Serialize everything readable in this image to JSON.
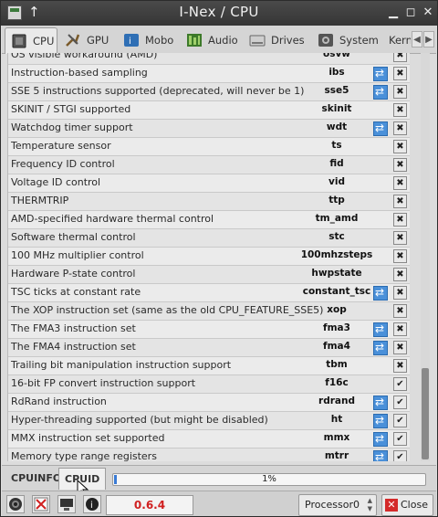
{
  "window": {
    "title": "I-Nex / CPU"
  },
  "tabs": [
    {
      "label": "CPU",
      "icon": "cpu-icon"
    },
    {
      "label": "GPU",
      "icon": "gpu-icon"
    },
    {
      "label": "Mobo",
      "icon": "motherboard-icon"
    },
    {
      "label": "Audio",
      "icon": "audio-icon"
    },
    {
      "label": "Drives",
      "icon": "drive-icon"
    },
    {
      "label": "System",
      "icon": "system-icon"
    },
    {
      "label": "Kern",
      "icon": "kernel-icon"
    }
  ],
  "flags": [
    {
      "desc": "OS visible workaround (AMD)",
      "flag": "osvw",
      "ok": false
    },
    {
      "desc": "Instruction-based sampling",
      "flag": "ibs",
      "ok": true
    },
    {
      "desc": "SSE 5 instructions supported (deprecated, will never be 1)",
      "flag": "sse5",
      "ok": true
    },
    {
      "desc": "SKINIT / STGI supported",
      "flag": "skinit",
      "ok": false
    },
    {
      "desc": "Watchdog timer support",
      "flag": "wdt",
      "ok": true
    },
    {
      "desc": "Temperature sensor",
      "flag": "ts",
      "ok": false
    },
    {
      "desc": "Frequency ID control",
      "flag": "fid",
      "ok": false
    },
    {
      "desc": "Voltage ID control",
      "flag": "vid",
      "ok": false
    },
    {
      "desc": "THERMTRIP",
      "flag": "ttp",
      "ok": false
    },
    {
      "desc": "AMD-specified hardware thermal control",
      "flag": "tm_amd",
      "ok": false
    },
    {
      "desc": "Software thermal control",
      "flag": "stc",
      "ok": false
    },
    {
      "desc": "100 MHz multiplier control",
      "flag": "100mhzsteps",
      "ok": false
    },
    {
      "desc": "Hardware P-state control",
      "flag": "hwpstate",
      "ok": false
    },
    {
      "desc": "TSC ticks at constant rate",
      "flag": "constant_tsc",
      "ok": true
    },
    {
      "desc": "The XOP instruction set (same as the old CPU_FEATURE_SSE5)",
      "flag": "xop",
      "ok": false
    },
    {
      "desc": "The FMA3 instruction set",
      "flag": "fma3",
      "ok": true
    },
    {
      "desc": "The FMA4 instruction set",
      "flag": "fma4",
      "ok": true
    },
    {
      "desc": "Trailing bit manipulation instruction support",
      "flag": "tbm",
      "ok": false
    },
    {
      "desc": "16-bit FP convert instruction support",
      "flag": "f16c",
      "ok": false,
      "check": true
    },
    {
      "desc": "RdRand instruction",
      "flag": "rdrand",
      "ok": true,
      "check": true
    },
    {
      "desc": "Hyper-threading supported (but might be disabled)",
      "flag": "ht",
      "ok": true,
      "check": true
    },
    {
      "desc": "MMX instruction set supported",
      "flag": "mmx",
      "ok": true,
      "check": true
    },
    {
      "desc": "Memory type range registers",
      "flag": "mtrr",
      "ok": true,
      "check": true
    }
  ],
  "bottom_tabs": [
    "CPUINFO",
    "CPUID"
  ],
  "progress": {
    "text": "1%",
    "fraction": 0.01
  },
  "status": {
    "version": "0.6.4",
    "processor": "Processor0",
    "close": "Close"
  }
}
